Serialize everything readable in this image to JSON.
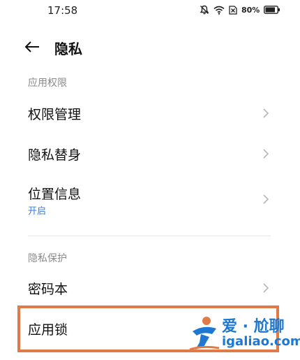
{
  "status_bar": {
    "time": "17:58",
    "battery": "80%",
    "icons": [
      "mute-icon",
      "wifi-icon",
      "sim-off-icon",
      "battery-icon"
    ]
  },
  "header": {
    "title": "隐私",
    "back_icon": "back-arrow-icon"
  },
  "sections": [
    {
      "label": "应用权限",
      "items": [
        {
          "label": "权限管理"
        },
        {
          "label": "隐私替身"
        },
        {
          "label": "位置信息",
          "sub": "开启"
        }
      ]
    },
    {
      "label": "隐私保护",
      "items": [
        {
          "label": "密码本"
        },
        {
          "label": "应用锁"
        }
      ]
    }
  ],
  "watermark": {
    "text_cn": "爱 · 尬聊",
    "text_en": "igaliao.com"
  },
  "colors": {
    "accent_blue": "#3a7bd5",
    "highlight_orange": "#e07a47",
    "watermark_blue": "#1e78d2"
  }
}
